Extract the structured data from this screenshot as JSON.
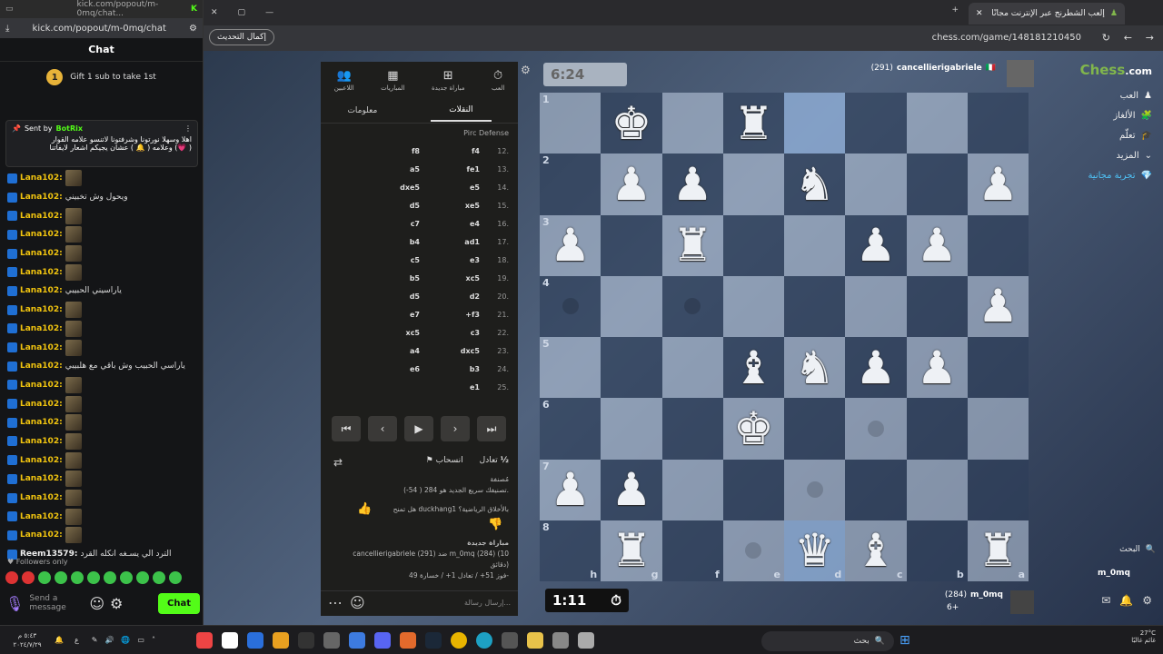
{
  "kick": {
    "url_short": "kick.com/popout/m-0mq/chat...",
    "url": "kick.com/popout/m-0mq/chat",
    "title": "Chat",
    "gift_num": "1",
    "gift_text": "Gift 1 sub to take 1st",
    "pinned_label": "Sent by",
    "pinned_user": "BotRix",
    "pinned_line1": "اهلا وسهلا نورتونا وشرفتونا لاتنسو علامه القوار",
    "pinned_line2": "( 💗) وعلامه ( 🔔 ) عشان يجيكم اشعار لايفاتنا",
    "messages": [
      {
        "user": "Lana102:",
        "text": "",
        "emote": true
      },
      {
        "user": "Lana102:",
        "text": "ويحول وش تخبيني",
        "emote": false
      },
      {
        "user": "Lana102:",
        "text": "",
        "emote": true
      },
      {
        "user": "Lana102:",
        "text": "",
        "emote": true
      },
      {
        "user": "Lana102:",
        "text": "",
        "emote": true
      },
      {
        "user": "Lana102:",
        "text": "",
        "emote": true
      },
      {
        "user": "Lana102:",
        "text": "ياراسيني الحبيبي",
        "emote": false
      },
      {
        "user": "Lana102:",
        "text": "",
        "emote": true
      },
      {
        "user": "Lana102:",
        "text": "",
        "emote": true
      },
      {
        "user": "Lana102:",
        "text": "",
        "emote": true
      },
      {
        "user": "Lana102:",
        "text": "ياراسي الحبيب وش باقي مع هلبيبي",
        "emote": false
      },
      {
        "user": "Lana102:",
        "text": "",
        "emote": true
      },
      {
        "user": "Lana102:",
        "text": "",
        "emote": true
      },
      {
        "user": "Lana102:",
        "text": "",
        "emote": true
      },
      {
        "user": "Lana102:",
        "text": "",
        "emote": true
      },
      {
        "user": "Lana102:",
        "text": "",
        "emote": true
      },
      {
        "user": "Lana102:",
        "text": "",
        "emote": true
      },
      {
        "user": "Lana102:",
        "text": "",
        "emote": true
      },
      {
        "user": "Lana102:",
        "text": "",
        "emote": true
      },
      {
        "user": "Lana102:",
        "text": "",
        "emote": true
      },
      {
        "user": "Reem13579:",
        "text": "الترد الي يسـغه انكله القرد",
        "emote": false
      }
    ],
    "followers_only": "Followers only",
    "send_placeholder": "Send a message",
    "chat_button": "Chat"
  },
  "browser": {
    "tab_title": "إلعب الشطرنج عبر الإنترنت مجانًا",
    "url": "chess.com/game/148181210450",
    "update_button": "إكمال التحديث"
  },
  "chess": {
    "nav": [
      {
        "label": "العب",
        "icon": "clock-icon"
      },
      {
        "label": "مباراة جديدة",
        "icon": "plus-icon"
      },
      {
        "label": "المباريات",
        "icon": "board-icon"
      },
      {
        "label": "اللاعبين",
        "icon": "players-icon"
      }
    ],
    "tabs": {
      "moves": "النقلات",
      "info": "معلومات"
    },
    "opening": "Pirc Defense",
    "moves": [
      {
        "n": "12.",
        "w": "f4",
        "b": "f8"
      },
      {
        "n": "13.",
        "w": "fe1",
        "b": "a5"
      },
      {
        "n": "14.",
        "w": "e5",
        "b": "dxe5"
      },
      {
        "n": "15.",
        "w": "xe5",
        "b": "d5"
      },
      {
        "n": "16.",
        "w": "e4",
        "b": "c7"
      },
      {
        "n": "17.",
        "w": "ad1",
        "b": "b4"
      },
      {
        "n": "18.",
        "w": "e3",
        "b": "c5"
      },
      {
        "n": "19.",
        "w": "xc5",
        "b": "b5"
      },
      {
        "n": "20.",
        "w": "d2",
        "b": "d5"
      },
      {
        "n": "21.",
        "w": "+f3",
        "b": "e7"
      },
      {
        "n": "22.",
        "w": "c3",
        "b": "xc5"
      },
      {
        "n": "23.",
        "w": "dxc5",
        "b": "a4"
      },
      {
        "n": "24.",
        "w": "b3",
        "b": "e6"
      },
      {
        "n": "25.",
        "w": "e1",
        "b": ""
      }
    ],
    "draw": "تعادل",
    "draw_half": "½",
    "resign": "انسحاب",
    "rated": "مُصنفة",
    "rating_text": "تصنيفك سريع الجديد هو 284 ( 54-).",
    "duckhang_q": "هل تمنح duckhang1 بالأخلاق الرياضية؟",
    "new_game": "مباراة جديدة",
    "game_line": "cancellierigabriele (291) ضد m_0mq (284) (10",
    "minutes": "دقائق)",
    "record": "فوز 51+ / تعادل 1+ / خسارة 49-",
    "send_msg": "إرسال رسالة...",
    "top_player": "cancellierigabriele",
    "top_rating": "(291)",
    "bottom_player": "m_0mq",
    "bottom_rating": "(284)",
    "top_clock": "6:24",
    "bottom_clock": "1:11",
    "material": "6+",
    "ranks": [
      "1",
      "2",
      "3",
      "4",
      "5",
      "6",
      "7",
      "8"
    ],
    "files": [
      "h",
      "g",
      "f",
      "e",
      "d",
      "c",
      "b",
      "a"
    ],
    "board": [
      [
        "",
        "♚",
        "",
        "♜",
        "",
        "",
        "",
        ""
      ],
      [
        "",
        "♟",
        "♟",
        "",
        "♞",
        "",
        "",
        "♟"
      ],
      [
        "♟",
        "",
        "♜",
        "",
        "",
        "♟",
        "♟",
        ""
      ],
      [
        "",
        "",
        "",
        "",
        "",
        "",
        "",
        "♟"
      ],
      [
        "",
        "",
        "",
        "♝",
        "♞",
        "♟",
        "♟",
        ""
      ],
      [
        "",
        "",
        "",
        "♚",
        "",
        "",
        "",
        ""
      ],
      [
        "♟",
        "♟",
        "",
        "",
        "",
        "",
        "",
        ""
      ],
      [
        "",
        "♜",
        "",
        "",
        "♛",
        "♝",
        "",
        "♜"
      ]
    ],
    "sidebar": [
      {
        "label": "العب",
        "icon": "play-icon"
      },
      {
        "label": "الألغاز",
        "icon": "puzzle-icon"
      },
      {
        "label": "تعلّم",
        "icon": "learn-icon"
      },
      {
        "label": "المزيد",
        "icon": "more-icon"
      },
      {
        "label": "تجربة مجانية",
        "icon": "diamond-icon"
      }
    ],
    "logo_main": "Chess",
    "logo_suffix": ".com",
    "search_label": "البحث",
    "user_label": "m_0mq"
  },
  "taskbar": {
    "time": "٥:٤٣ م",
    "date": "٢٠٢٤/٧/٢٩",
    "search": "بحث",
    "weather_temp": "27°C",
    "weather_text": "غائم غالبًا",
    "lang": "ع"
  },
  "colors": {
    "kick_green": "#53fc18",
    "chess_green": "#81b64c"
  }
}
